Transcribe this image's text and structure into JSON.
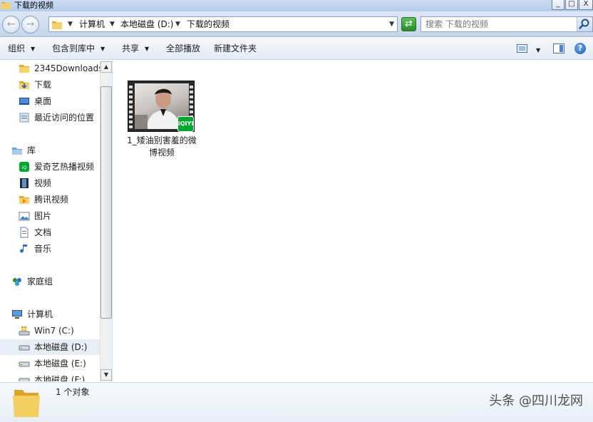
{
  "window": {
    "title": "下载的视频",
    "buttons": {
      "minimize": "_",
      "maximize": "□",
      "close": "X"
    }
  },
  "address": {
    "crumbs": [
      "计算机",
      "本地磁盘 (D:)",
      "下载的视频"
    ],
    "search_placeholder": "搜索 下载的视频"
  },
  "toolbar": {
    "organize": "组织",
    "include_in_library": "包含到库中",
    "share": "共享",
    "play_all": "全部播放",
    "new_folder": "新建文件夹",
    "help": "?"
  },
  "sidebar": {
    "items": [
      {
        "label": "2345Downloads",
        "icon": "folder-icon"
      },
      {
        "label": "下载",
        "icon": "downloads-icon"
      },
      {
        "label": "桌面",
        "icon": "desktop-icon"
      },
      {
        "label": "最近访问的位置",
        "icon": "recent-places-icon"
      },
      {
        "label": "库",
        "icon": "library-icon"
      },
      {
        "label": "爱奇艺热播视频",
        "icon": "iqiyi-icon"
      },
      {
        "label": "视频",
        "icon": "videos-icon"
      },
      {
        "label": "腾讯视频",
        "icon": "tencent-video-icon"
      },
      {
        "label": "图片",
        "icon": "pictures-icon"
      },
      {
        "label": "文档",
        "icon": "documents-icon"
      },
      {
        "label": "音乐",
        "icon": "music-icon"
      },
      {
        "label": "家庭组",
        "icon": "homegroup-icon"
      },
      {
        "label": "计算机",
        "icon": "computer-icon"
      },
      {
        "label": "Win7 (C:)",
        "icon": "system-drive-icon"
      },
      {
        "label": "本地磁盘 (D:)",
        "icon": "drive-icon"
      },
      {
        "label": "本地磁盘 (E:)",
        "icon": "drive-icon"
      },
      {
        "label": "本地磁盘 (F:)",
        "icon": "drive-icon"
      }
    ]
  },
  "content": {
    "files": [
      {
        "name": "1_矮油别害羞的微博视频",
        "badge": "iQIYI"
      }
    ]
  },
  "status": {
    "count": "1 个对象",
    "watermark": "头条 @四川龙网"
  }
}
